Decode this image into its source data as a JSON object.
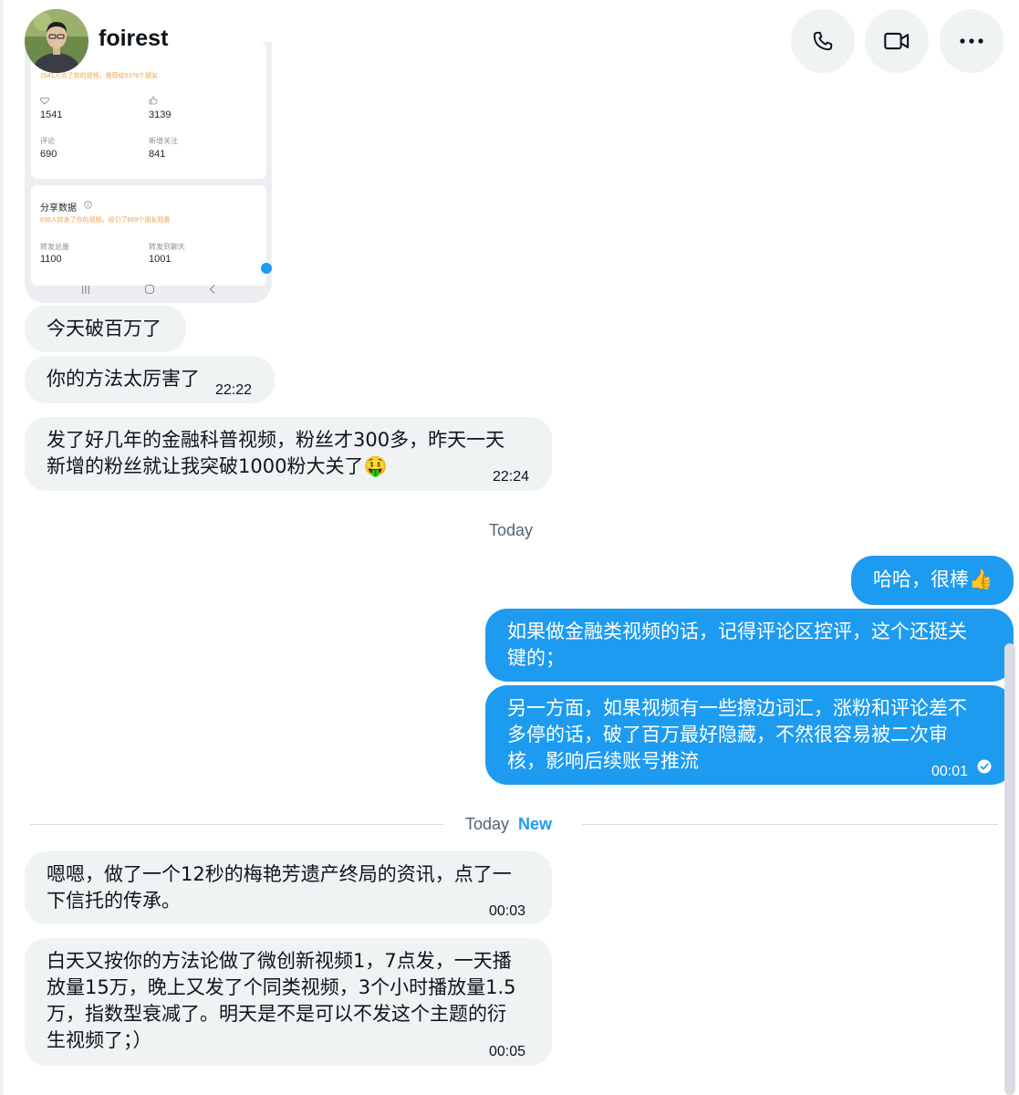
{
  "header": {
    "username": "foirest",
    "buttons": [
      {
        "name": "call-button",
        "icon": "phone-icon"
      },
      {
        "name": "video-call-button",
        "icon": "video-camera-icon"
      },
      {
        "name": "more-button",
        "icon": "more-horizontal-icon"
      }
    ]
  },
  "image_message": {
    "card1": {
      "header_text": "1541人点了你的视频，推荐给5378个朋友",
      "stats": [
        {
          "label": "",
          "value": "1541"
        },
        {
          "label": "",
          "value": "3139"
        },
        {
          "label": "评论",
          "value": "690"
        },
        {
          "label": "新增关注",
          "value": "841"
        }
      ]
    },
    "card2": {
      "title": "分享数据",
      "subtitle": "836人转发了你的视频，吸引了869个朋友观看",
      "stats": [
        {
          "label": "转发总量",
          "value": "1100"
        },
        {
          "label": "转发到聊天",
          "value": "1001"
        }
      ]
    }
  },
  "messages": [
    {
      "dir": "in",
      "text": "今天破百万了",
      "time": ""
    },
    {
      "dir": "in",
      "text": "你的方法太厉害了",
      "time": "22:22"
    },
    {
      "dir": "in",
      "text": "发了好几年的金融科普视频，粉丝才300多，昨天一天\n新增的粉丝就让我突破1000粉大关了🤑",
      "time": "22:24"
    },
    {
      "dir": "out",
      "text": "哈哈，很棒👍",
      "time": ""
    },
    {
      "dir": "out",
      "text": "如果做金融类视频的话，记得评论区控评，这个还挺关\n键的；",
      "time": ""
    },
    {
      "dir": "out",
      "text": "另一方面，如果视频有一些擦边词汇，涨粉和评论差不\n多停的话，破了百万最好隐藏，不然很容易被二次审\n核，影响后续账号推流",
      "time": "00:01"
    },
    {
      "dir": "in",
      "text": "嗯嗯，做了一个12秒的梅艳芳遗产终局的资讯，点了一\n下信托的传承。",
      "time": "00:03"
    },
    {
      "dir": "in",
      "text": "白天又按你的方法论做了微创新视频1，7点发，一天播\n放量15万，晚上又发了个同类视频，3个小时播放量1.5\n万，指数型衰减了。明天是不是可以不发这个主题的衍\n生视频了；）",
      "time": "00:05"
    }
  ],
  "dividers": {
    "today_1": "Today",
    "today_2": "Today",
    "new_label": "New"
  },
  "colors": {
    "outgoing_bubble": "#1d9bf0",
    "incoming_bubble": "#eff3f4",
    "new_label": "#1d9bf0"
  }
}
